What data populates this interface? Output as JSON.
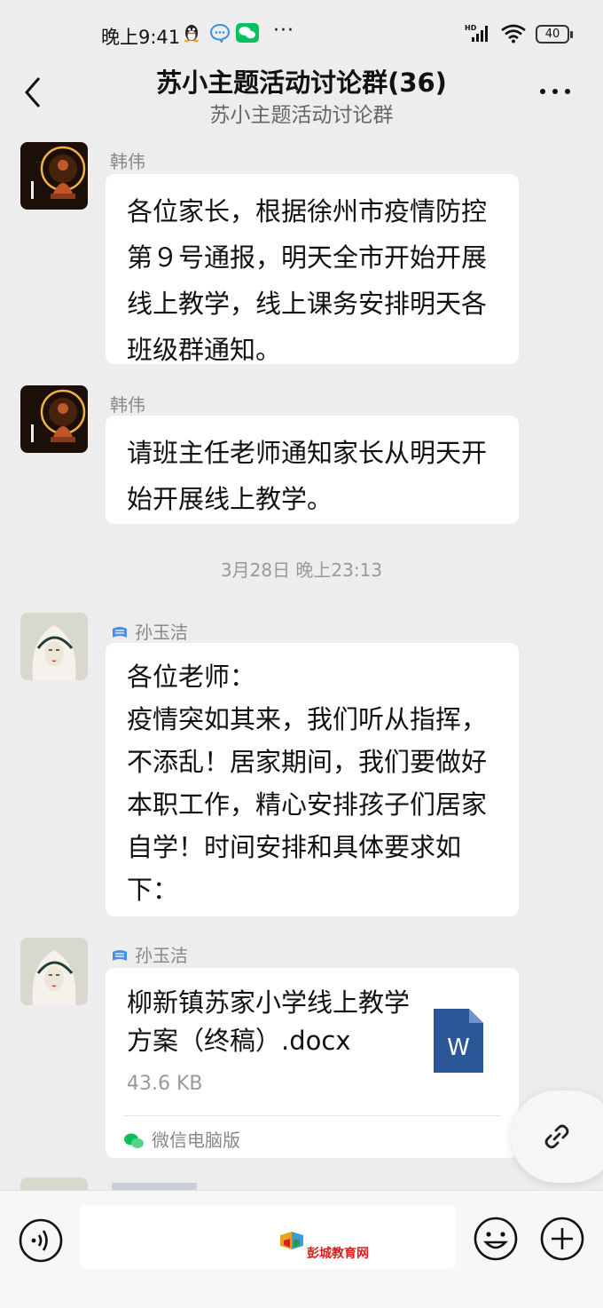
{
  "status_bar": {
    "time": "晚上9:41",
    "dots": "···",
    "network": "HD",
    "battery": "40"
  },
  "header": {
    "title": "苏小主题活动讨论群(36)",
    "subtitle": "苏小主题活动讨论群"
  },
  "messages": [
    {
      "sender": "韩伟",
      "text": "各位家长，根据徐州市疫情防控第９号通报，明天全市开始开展线上教学，线上课务安排明天各班级群通知。"
    },
    {
      "sender": "韩伟",
      "text": "请班主任老师通知家长从明天开始开展线上教学。"
    },
    {
      "sender": "孙玉洁",
      "text": "各位老师：\n疫情突如其来，我们听从指挥，不添乱！居家期间，我们要做好本职工作，精心安排孩子们居家自学！时间安排和具体要求如下："
    }
  ],
  "timestamp": "3月28日 晚上23:13",
  "file_message": {
    "sender": "孙玉洁",
    "file_name": "柳新镇苏家小学线上教学方案（终稿）.docx",
    "file_size": "43.6 KB",
    "file_type_letter": "W",
    "source": "微信电脑版"
  },
  "input_bar": {
    "watermark": "彭城教育网"
  },
  "colors": {
    "background": "#ededed",
    "bubble": "#ffffff",
    "word_icon": "#2b5797",
    "wechat_green": "#07c160"
  }
}
